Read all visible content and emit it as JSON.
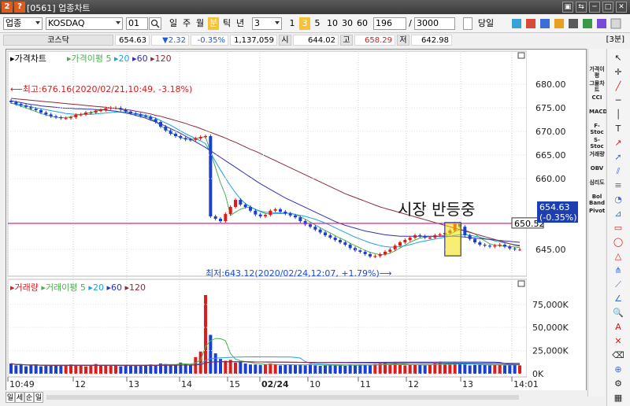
{
  "window": {
    "title": "[0561] 업종차트",
    "icon1": "2",
    "icon2": "?",
    "controls": [
      "▣",
      "⇆",
      "─",
      "□",
      "✕"
    ]
  },
  "toolbar": {
    "type_select": "업종",
    "market_input": "KOSDAQ",
    "code_input": "01",
    "search_icon": "search-icon",
    "periods": [
      "일",
      "주",
      "월",
      "분",
      "틱",
      "년"
    ],
    "selected_period": "분",
    "period_value": "3",
    "minute_buttons": [
      "1",
      "3",
      "5",
      "10",
      "30",
      "60"
    ],
    "selected_minute": "3",
    "count_value": "196",
    "total_value": "3000",
    "today_label": "당일"
  },
  "quote": {
    "name": "코스닥",
    "price": "654.63",
    "change": "▼2.32",
    "change_pct": "-0.35%",
    "volume": "1,137,059",
    "open_label": "시",
    "open": "644.02",
    "high_label": "고",
    "high": "658.29",
    "low_label": "저",
    "low": "642.98",
    "interval_label": "[3분]"
  },
  "price_panel": {
    "legend": {
      "price_label": "가격차트",
      "ma_label": "가격이평",
      "ma_periods": [
        "5",
        "20",
        "60",
        "120"
      ],
      "ma_colors": [
        "#4caf50",
        "#1ea0e0",
        "#2f2fb4",
        "#8b2b3a"
      ]
    },
    "y_ticks": [
      "680.00",
      "675.00",
      "670.00",
      "665.00",
      "660.00",
      "645.00"
    ],
    "y_tick_values": [
      680,
      675,
      670,
      665,
      660,
      645
    ],
    "high_annotation": "최고:676.16(2020/02/21,10:49, -3.18%)",
    "low_annotation": "최저:643.12(2020/02/24,12:07, +1.79%)",
    "current_price_box": [
      "654.63",
      "(-0.35%)"
    ],
    "hline_value_label": "650.52",
    "hline_value": 650.52,
    "rebound_text": "시장 반등중"
  },
  "volume_panel": {
    "legend": {
      "volume_label": "거래량",
      "ma_label": "거래이평",
      "ma_periods": [
        "5",
        "20",
        "60",
        "120"
      ]
    },
    "y_ticks": [
      "75,000K",
      "50,000K",
      "25,000K",
      "0K"
    ]
  },
  "x_axis": {
    "labels": [
      "10:49",
      "12",
      "13",
      "14",
      "15",
      "02/24",
      "10",
      "11",
      "12",
      "13",
      "14:01"
    ]
  },
  "bottom_tabs": [
    "일",
    "세",
    "순",
    "일"
  ],
  "right_strip": [
    "가격이평",
    "그물차트",
    "CCI",
    "MACD",
    "F-Stoc",
    "S-Stoc",
    "거래량",
    "OBV",
    "심리도",
    "Bol Band",
    "Pivot"
  ],
  "right_tools": [
    "cursor-icon",
    "crosshair-icon",
    "line-icon",
    "hline-icon",
    "vline-icon",
    "text-icon",
    "ray-icon",
    "arrow-icon",
    "channel-icon",
    "fib-icon",
    "cycle-icon",
    "gann-icon",
    "rect-icon",
    "ellipse-icon",
    "triangle-icon",
    "pitchfork-icon",
    "speed-icon",
    "angle-icon",
    "zoom-icon",
    "auto-icon",
    "delete-icon",
    "eraser-icon",
    "magnet-icon",
    "settings-icon",
    "grid-icon"
  ],
  "chart_data": {
    "type": "candlestick",
    "title": "",
    "xlabel": "",
    "ylabel": "",
    "ylim": [
      641,
      683
    ],
    "volume_ylim": [
      0,
      85000
    ],
    "series": [
      {
        "name": "가격",
        "values": [
          676.2,
          675.8,
          675.5,
          675.2,
          674.8,
          674.5,
          674.0,
          673.6,
          673.2,
          673.0,
          672.8,
          672.8,
          673.0,
          673.5,
          673.6,
          674.0,
          674.0,
          674.4,
          674.5,
          674.9,
          675.0,
          675.0,
          674.6,
          674.2,
          673.8,
          673.6,
          673.3,
          673.1,
          672.6,
          672.0,
          671.0,
          670.2,
          669.5,
          669.0,
          668.6,
          668.3,
          668.2,
          668.5,
          668.8,
          669.0,
          652.0,
          651.5,
          651.0,
          652.5,
          654.0,
          655.5,
          654.5,
          654.0,
          653.2,
          652.4,
          652.0,
          652.3,
          653.2,
          653.5,
          653.0,
          652.6,
          652.2,
          651.8,
          651.0,
          650.3,
          649.8,
          649.2,
          648.6,
          648.0,
          647.5,
          647.0,
          646.5,
          646.0,
          645.3,
          644.8,
          644.5,
          644.0,
          643.5,
          643.6,
          644.0,
          644.5,
          645.0,
          645.8,
          646.5,
          647.0,
          647.5,
          648.0,
          647.8,
          647.5,
          647.5,
          648.0,
          648.2,
          648.5,
          649.0,
          650.5,
          649.8,
          648.0,
          647.2,
          646.5,
          646.0,
          645.8,
          645.6,
          645.8,
          646.0,
          645.6,
          645.2,
          645.0,
          645.0
        ]
      },
      {
        "name": "5",
        "values": [
          676.0,
          675.7,
          675.3,
          675.0,
          674.6,
          674.2,
          673.8,
          673.5,
          673.2,
          673.0,
          672.9,
          672.9,
          673.1,
          673.4,
          673.6,
          673.8,
          674.0,
          674.3,
          674.5,
          674.8,
          674.9,
          674.9,
          674.7,
          674.3,
          674.0,
          673.7,
          673.4,
          673.1,
          672.7,
          672.1,
          671.2,
          670.5,
          669.8,
          669.2,
          668.7,
          668.4,
          668.3,
          668.5,
          668.7,
          668.9,
          665.6,
          662.3,
          659.1,
          656.5,
          652.2,
          652.9,
          653.5,
          653.9,
          653.9,
          653.5,
          653.0,
          652.6,
          652.5,
          652.6,
          652.6,
          652.6,
          652.7,
          652.4,
          651.9,
          651.4,
          650.8,
          650.2,
          649.6,
          649.0,
          648.5,
          647.9,
          647.4,
          646.9,
          646.3,
          645.8,
          645.3,
          644.8,
          644.4,
          644.1,
          643.9,
          643.9,
          644.2,
          644.7,
          645.3,
          645.9,
          646.5,
          647.0,
          647.4,
          647.6,
          647.7,
          647.8,
          647.8,
          648.0,
          648.2,
          648.8,
          649.2,
          649.1,
          648.7,
          648.3,
          647.5,
          646.8,
          646.2,
          645.9,
          645.8,
          645.7,
          645.6,
          645.5,
          645.4
        ]
      },
      {
        "name": "20",
        "values": [
          676.0,
          675.8,
          675.6,
          675.4,
          675.2,
          675.0,
          674.8,
          674.6,
          674.4,
          674.2,
          674.0,
          673.8,
          673.7,
          673.6,
          673.6,
          673.6,
          673.6,
          673.7,
          673.8,
          673.9,
          674.0,
          674.1,
          674.1,
          674.0,
          673.9,
          673.8,
          673.6,
          673.4,
          673.1,
          672.8,
          672.3,
          671.8,
          671.3,
          670.7,
          670.1,
          669.5,
          669.0,
          668.5,
          668.0,
          667.4,
          665.5,
          663.6,
          661.8,
          660.1,
          658.5,
          657.0,
          655.7,
          654.7,
          654.0,
          653.5,
          653.1,
          652.9,
          652.8,
          652.8,
          652.7,
          652.7,
          652.6,
          652.4,
          652.2,
          652.0,
          651.7,
          651.4,
          651.0,
          650.6,
          650.1,
          649.6,
          649.1,
          648.6,
          648.1,
          647.6,
          647.2,
          646.8,
          646.4,
          646.1,
          645.8,
          645.6,
          645.5,
          645.5,
          645.6,
          645.8,
          646.0,
          646.3,
          646.6,
          646.8,
          647.0,
          647.2,
          647.4,
          647.6,
          647.8,
          648.0,
          648.1,
          648.1,
          648.0,
          647.8,
          647.6,
          647.3,
          647.1,
          646.8,
          646.6,
          646.4,
          646.2,
          646.0,
          645.9
        ]
      },
      {
        "name": "60",
        "values": [
          676.5,
          676.3,
          676.1,
          675.9,
          675.7,
          675.6,
          675.4,
          675.3,
          675.2,
          675.1,
          675.0,
          674.9,
          674.9,
          674.8,
          674.8,
          674.7,
          674.7,
          674.6,
          674.6,
          674.5,
          674.4,
          674.3,
          674.1,
          673.9,
          673.7,
          673.4,
          673.1,
          672.8,
          672.4,
          672.0,
          671.6,
          671.1,
          670.6,
          670.1,
          669.6,
          669.0,
          668.4,
          667.8,
          667.2,
          666.6,
          665.9,
          665.2,
          664.5,
          663.8,
          663.1,
          662.4,
          661.7,
          661.0,
          660.3,
          659.6,
          658.9,
          658.3,
          657.7,
          657.1,
          656.5,
          655.9,
          655.4,
          654.9,
          654.4,
          653.9,
          653.4,
          652.9,
          652.4,
          651.9,
          651.4,
          650.9,
          650.5,
          650.1,
          649.8,
          649.5,
          649.2,
          648.9,
          648.7,
          648.5,
          648.3,
          648.1,
          648.0,
          647.9,
          647.8,
          647.8,
          647.8,
          647.8,
          647.8,
          647.8,
          647.8,
          647.8,
          647.8,
          647.8,
          647.8,
          647.8,
          647.7,
          647.6,
          647.5,
          647.4,
          647.3,
          647.2,
          647.1,
          647.0,
          646.9,
          646.8,
          646.7,
          646.6,
          646.5
        ]
      },
      {
        "name": "120",
        "values": [
          677.0,
          676.9,
          676.8,
          676.7,
          676.6,
          676.5,
          676.4,
          676.3,
          676.2,
          676.1,
          676.0,
          675.9,
          675.8,
          675.7,
          675.6,
          675.5,
          675.4,
          675.3,
          675.2,
          675.1,
          675.0,
          674.9,
          674.8,
          674.6,
          674.5,
          674.3,
          674.1,
          673.9,
          673.7,
          673.4,
          673.2,
          672.9,
          672.6,
          672.3,
          672.0,
          671.7,
          671.3,
          671.0,
          670.6,
          670.2,
          669.8,
          669.4,
          669.0,
          668.6,
          668.1,
          667.7,
          667.2,
          666.7,
          666.2,
          665.8,
          665.3,
          664.8,
          664.3,
          663.8,
          663.3,
          662.8,
          662.3,
          661.8,
          661.3,
          660.8,
          660.3,
          659.8,
          659.3,
          658.8,
          658.3,
          657.8,
          657.3,
          656.8,
          656.4,
          656.0,
          655.6,
          655.2,
          654.8,
          654.4,
          654.0,
          653.7,
          653.4,
          653.1,
          652.8,
          652.5,
          652.2,
          651.9,
          651.6,
          651.3,
          651.0,
          650.7,
          650.4,
          650.1,
          649.8,
          649.5,
          649.2,
          648.9,
          648.6,
          648.3,
          648.0,
          647.7,
          647.4,
          647.1,
          646.8,
          646.5,
          646.2,
          645.9,
          645.7
        ]
      },
      {
        "name": "거래량",
        "values": [
          11000,
          9000,
          10000,
          8000,
          9000,
          10000,
          8000,
          9000,
          8500,
          9000,
          9500,
          8500,
          10000,
          9000,
          9500,
          8000,
          9000,
          10500,
          9000,
          9500,
          8500,
          9000,
          8000,
          9500,
          9000,
          8500,
          9000,
          9500,
          10000,
          9000,
          11000,
          10500,
          9500,
          10000,
          12000,
          11000,
          9000,
          18000,
          24000,
          85000,
          42000,
          22000,
          16000,
          14000,
          15000,
          12000,
          13000,
          11000,
          10000,
          10000,
          9500,
          10000,
          11000,
          10000,
          9000,
          9500,
          10000,
          9500,
          10000,
          9000,
          10500,
          9000,
          8500,
          9000,
          10000,
          9500,
          9000,
          8500,
          10000,
          9000,
          10000,
          9500,
          9000,
          10500,
          11000,
          12000,
          10000,
          11500,
          10000,
          9000,
          9500,
          10000,
          9500,
          9000,
          10000,
          11000,
          12000,
          10500,
          10000,
          12000,
          11000,
          10000,
          9000,
          9500,
          10000,
          9500,
          9000,
          9500,
          10000,
          9000,
          9500,
          10000,
          9000
        ]
      }
    ]
  }
}
